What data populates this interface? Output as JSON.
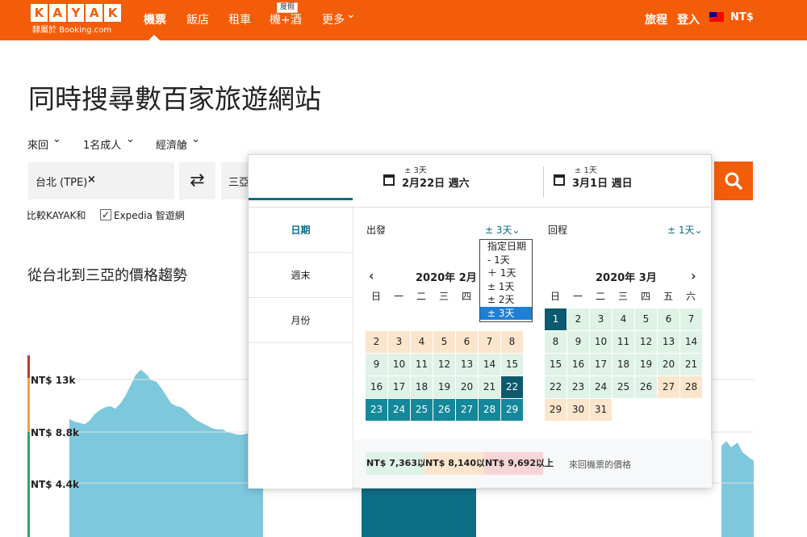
{
  "header": {
    "logo_letters": [
      "K",
      "A",
      "Y",
      "A",
      "K"
    ],
    "logo_sub": "隸屬於 Booking.com",
    "nav": [
      "機票",
      "飯店",
      "租車",
      "機+酒",
      "更多"
    ],
    "nav_badge": "度假",
    "more_arrow": "⌄",
    "trips": "旅程",
    "login": "登入",
    "currency": "NT$",
    "flag": "taiwan-flag",
    "brand_color": "#f35d0a"
  },
  "page": {
    "headline": "同時搜尋數百家旅遊網站",
    "trip_type": "來回",
    "travelers": "1名成人",
    "cabin": "經濟艙",
    "chev": "⌄",
    "origin": "台北 (TPE)",
    "origin_clear": "×",
    "swap_icon": "⇄",
    "destination": "三亞",
    "compare_label": "比較KAYAK和",
    "compare_checked": "✓",
    "compare_site": "Expedia 智遊網",
    "trend_title": "從台北到三亞的價格趨勢"
  },
  "chart_data": {
    "type": "area",
    "title": "從台北到三亞的價格趨勢",
    "y_ticks": [
      "NT$ 13k",
      "NT$ 8.8k",
      "NT$ 4.4k"
    ],
    "series": [
      {
        "values": [
          9400,
          9200,
          9100,
          9000,
          9300,
          9800,
          10100,
          10300,
          10400,
          10200,
          10600,
          11200,
          12000,
          12800,
          13200,
          12900,
          12400,
          12300,
          11800,
          11200,
          10600,
          10400,
          10300,
          10000,
          9600,
          9300,
          9100,
          8900,
          8700,
          8600,
          8600,
          8400,
          8300,
          8200,
          8200,
          8300,
          8100,
          8000,
          7900
        ]
      }
    ],
    "highlight_range": "selected travel window",
    "area_color": "#7ec8dd",
    "highlight_color": "#0d6e86"
  },
  "picker": {
    "depart_tol": "± 3天",
    "depart_date": "2月22日 週六",
    "return_tol": "± 1天",
    "return_date": "3月1日 週日",
    "tabs": [
      "日期",
      "週末",
      "月份"
    ],
    "depart_label": "出發",
    "depart_dd": "± 3天⌄",
    "return_label": "回程",
    "return_dd": "± 1天⌄",
    "feb_title": "2020年 2月",
    "mar_title": "2020年 3月",
    "prev": "‹",
    "next": "›",
    "weekdays": [
      "日",
      "一",
      "二",
      "三",
      "四",
      "五",
      "六"
    ],
    "feb_weekdays": [
      "日",
      "一",
      "二",
      "三",
      "四"
    ],
    "dropdown": [
      "指定日期",
      "- 1天",
      "＋ 1天",
      "± 1天",
      "± 2天",
      "± 3天"
    ],
    "feb_days": [
      [
        "2",
        "3",
        "4",
        "5",
        "6",
        "7",
        "8"
      ],
      [
        "9",
        "10",
        "11",
        "12",
        "13",
        "14",
        "15"
      ],
      [
        "16",
        "17",
        "18",
        "19",
        "20",
        "21",
        "22"
      ],
      [
        "23",
        "24",
        "25",
        "26",
        "27",
        "28",
        "29"
      ]
    ],
    "mar_days": [
      [
        "1",
        "2",
        "3",
        "4",
        "5",
        "6",
        "7"
      ],
      [
        "8",
        "9",
        "10",
        "11",
        "12",
        "13",
        "14"
      ],
      [
        "15",
        "16",
        "17",
        "18",
        "19",
        "20",
        "21"
      ],
      [
        "22",
        "23",
        "24",
        "25",
        "26",
        "27",
        "28"
      ],
      [
        "29",
        "30",
        "31"
      ]
    ],
    "legend": [
      "NT$ 7,363以上",
      "NT$ 8,140以上",
      "NT$ 9,692以上"
    ],
    "legend_note": "來回機票的價格",
    "colors": {
      "green": "#dff2e6",
      "orange": "#fbe5cd",
      "red": "#f7d4d6",
      "selected": "#14889a",
      "dark": "#0d5a6e"
    }
  }
}
